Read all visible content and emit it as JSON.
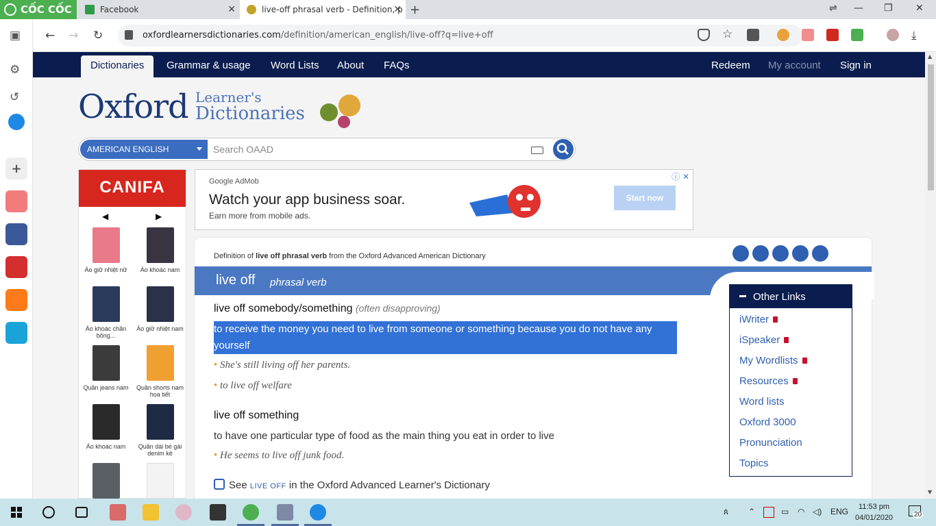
{
  "browser": {
    "brand": "CỐC CỐC",
    "tabs": [
      {
        "title": "Facebook",
        "active": false
      },
      {
        "title": "live-off phrasal verb - Definition, p",
        "active": true
      }
    ],
    "url_host": "oxfordlearnersdictionaries.com",
    "url_path": "/definition/american_english/live-off?q=live+off"
  },
  "site": {
    "nav": {
      "items": [
        "Dictionaries",
        "Grammar & usage",
        "Word Lists",
        "About",
        "FAQs"
      ],
      "right": [
        "Redeem",
        "My account",
        "Sign in"
      ]
    },
    "logo": {
      "oxford": "Oxford",
      "learners": "Learner's",
      "dictionaries": "Dictionaries"
    },
    "search": {
      "dictionary": "AMERICAN ENGLISH",
      "placeholder": "Search OAAD"
    },
    "left_ad": {
      "brand": "CANIFA",
      "products": [
        "Áo giữ nhiệt nữ",
        "Áo khoác nam",
        "Áo khoác chần bông...",
        "Áo giữ nhiệt nam",
        "Quần jeans nam",
        "Quần shorts nam họa tiết",
        "Áo khoác nam",
        "Quần dài bé gái denim kẻ"
      ],
      "product_colors": [
        "#e97a8a",
        "#3a3442",
        "#2b3b5c",
        "#2a3148",
        "#3b3b3b",
        "#f0a030",
        "#2a2a2a",
        "#1f2a45",
        "#5a5f66",
        "#f3f3f3"
      ]
    },
    "top_ad": {
      "network": "Google AdMob",
      "headline": "Watch your app business soar.",
      "sub": "Earn more from mobile ads.",
      "cta": "Start now"
    },
    "entry": {
      "def_of_prefix": "Definition of ",
      "def_of_word": "live off phrasal verb",
      "def_of_suffix": " from the Oxford Advanced American Dictionary",
      "headword": "live off",
      "pos": "phrasal verb",
      "sense1": {
        "phrase": "live off somebody/something",
        "label": "(often disapproving)",
        "def": "to receive the money you need to live from someone or something because you do not have any yourself",
        "examples": [
          "She's still living off her parents.",
          "to live off welfare"
        ]
      },
      "sense2": {
        "phrase": "live off something",
        "def": "to have one particular type of food as the main thing you eat in order to live",
        "examples": [
          "He seems to live off junk food."
        ]
      },
      "see": {
        "prefix": "See ",
        "word": "LIVE OFF",
        "suffix": " in the Oxford Advanced Learner's Dictionary"
      }
    },
    "other_links": {
      "title": "Other Links",
      "items": [
        {
          "label": "iWriter"
        },
        {
          "label": "iSpeaker"
        },
        {
          "label": "My Wordlists"
        },
        {
          "label": "Resources"
        },
        {
          "label": "Word lists"
        },
        {
          "label": "Oxford 3000"
        },
        {
          "label": "Pronunciation"
        },
        {
          "label": "Topics"
        }
      ]
    }
  },
  "taskbar": {
    "lang": "ENG",
    "time": "11:53 pm",
    "date": "04/01/2020",
    "notifications": "20"
  },
  "colors": {
    "navy": "#0b1d4f",
    "oxford_blue": "#4a78c2",
    "highlight": "#3271d6",
    "canifa_red": "#d7261e"
  }
}
